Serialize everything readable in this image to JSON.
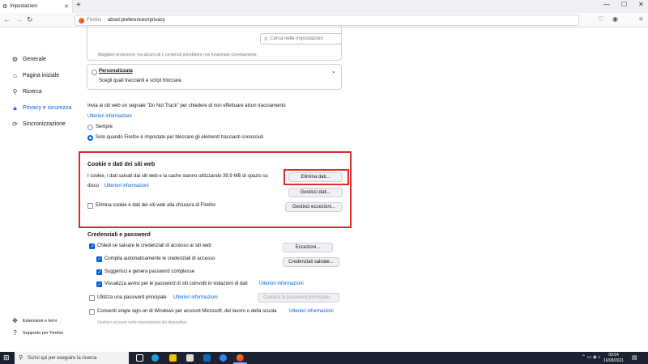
{
  "browser": {
    "tab_title": "Impostazioni",
    "url_prefix": "Firefox",
    "url": "about:preferences#privacy"
  },
  "search": {
    "placeholder": "Cerca nelle impostazioni"
  },
  "sidebar": {
    "items": [
      {
        "label": "Generale",
        "icon": "gear-icon"
      },
      {
        "label": "Pagina iniziale",
        "icon": "home-icon"
      },
      {
        "label": "Ricerca",
        "icon": "search-icon"
      },
      {
        "label": "Privacy e sicurezza",
        "icon": "lock-icon",
        "active": true
      },
      {
        "label": "Sincronizzazione",
        "icon": "sync-icon"
      }
    ],
    "bottom": [
      {
        "label": "Estensioni e temi",
        "icon": "puzzle-icon"
      },
      {
        "label": "Supporto per Firefox",
        "icon": "help-icon"
      }
    ]
  },
  "tracking": {
    "top_cut_text": "Maggiore protezione, ma alcuni siti o contenuti potrebbero non funzionare correttamente.",
    "custom_label": "Personalizzata",
    "custom_desc": "Scegli quali traccianti e script bloccare."
  },
  "dnt": {
    "text": "Invia ai siti web un segnale \"Do Not Track\" per chiedere di non effettuare alcun tracciamento",
    "link": "Ulteriori informazioni",
    "opt_always": "Sempre",
    "opt_only": "Solo quando Firefox è impostato per bloccare gli elementi traccianti conosciuti"
  },
  "cookies": {
    "title": "Cookie e dati dei siti web",
    "desc1": "I cookie, i dati salvati dai siti web e la cache stanno utilizzando 39,9 MB di spazio su",
    "desc2": "disco",
    "link": "Ulteriori informazioni",
    "clear_on_close": "Elimina cookie e dati dei siti web alla chiusura di Firefox",
    "btn_delete": "Elimina dati...",
    "btn_manage": "Gestisci dati...",
    "btn_exceptions": "Gestisci eccezioni..."
  },
  "passwords": {
    "title": "Credenziali e password",
    "ask_save": "Chiedi se salvare le credenziali di accesso ai siti web",
    "autofill": "Compila automaticamente le credenziali di accesso",
    "suggest": "Suggerisci e genera password complesse",
    "alerts": "Visualizza avvisi per le password di siti coinvolti in violazioni di dati",
    "alerts_link": "Ulteriori informazioni",
    "primary": "Utilizza una password principale",
    "primary_link": "Ulteriori informazioni",
    "sso": "Consenti single sign-on di Windows per account Microsoft, del lavoro o della scuola",
    "sso_link": "Ulteriori informazioni",
    "sso_note": "Gestisci account nelle impostazioni del dispositivo",
    "btn_exceptions": "Eccezioni...",
    "btn_saved": "Credenziali salvate...",
    "btn_change_primary": "Cambia la password principale..."
  },
  "taskbar": {
    "search_placeholder": "Scrivi qui per eseguire la ricerca",
    "time": "09:54",
    "date": "16/08/2021"
  },
  "colors": {
    "accent": "#0061e0",
    "highlight": "#e22828"
  }
}
